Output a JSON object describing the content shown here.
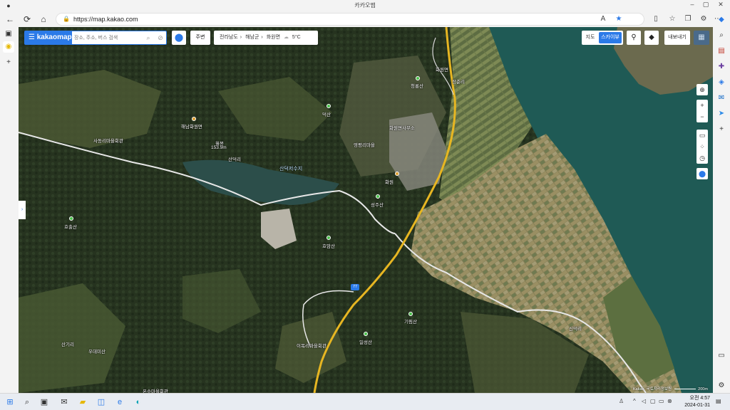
{
  "window": {
    "title": "카카오맵"
  },
  "browser": {
    "url": "https://map.kakao.com"
  },
  "search": {
    "logo": "kakaomap",
    "placeholder": "장소, 주소, 버스 검색"
  },
  "toolbar": {
    "around_label": "주변",
    "breadcrumb": [
      "전라남도",
      "해남군",
      "화원면"
    ],
    "weather": "5°C",
    "map_type": {
      "map": "지도",
      "skyview": "스카이뷰"
    },
    "export_label": "내보내기"
  },
  "map_labels": [
    {
      "text": "청룡산",
      "kind": "mountain"
    },
    {
      "text": "화원면",
      "kind": "town"
    },
    {
      "text": "장춘리",
      "kind": "village"
    },
    {
      "text": "화원면사무소",
      "kind": "poi"
    },
    {
      "text": "화원",
      "kind": "town"
    },
    {
      "text": "덕산",
      "kind": "mountain"
    },
    {
      "text": "해남화원면",
      "kind": "poi"
    },
    {
      "text": "영평리마을",
      "kind": "village"
    },
    {
      "text": "사동리마을회관",
      "kind": "village"
    },
    {
      "text": "월봉",
      "kind": "peak"
    },
    {
      "text": "153.9m",
      "kind": "elevation"
    },
    {
      "text": "산덕리",
      "kind": "village"
    },
    {
      "text": "산덕저수지",
      "kind": "water"
    },
    {
      "text": "성주산",
      "kind": "mountain"
    },
    {
      "text": "호출산",
      "kind": "mountain"
    },
    {
      "text": "호암산",
      "kind": "mountain"
    },
    {
      "text": "기림산",
      "kind": "mountain"
    },
    {
      "text": "일성산",
      "kind": "mountain"
    },
    {
      "text": "산기리",
      "kind": "village"
    },
    {
      "text": "우데미산",
      "kind": "mountain"
    },
    {
      "text": "신덕리",
      "kind": "village"
    },
    {
      "text": "이목리마을회관",
      "kind": "village"
    },
    {
      "text": "온수마을회관",
      "kind": "village"
    },
    {
      "text": "77",
      "kind": "road-number"
    }
  ],
  "map_footer": {
    "copyright": "Kakao, 국토지리정보원",
    "scale": "200m"
  },
  "taskbar": {
    "time": "오전 4:57",
    "date": "2024-01-31"
  },
  "colors": {
    "accent": "#2b7ae8",
    "water": "#1f5a55",
    "forest": "#2c3a26",
    "fields": "#8a8458"
  }
}
